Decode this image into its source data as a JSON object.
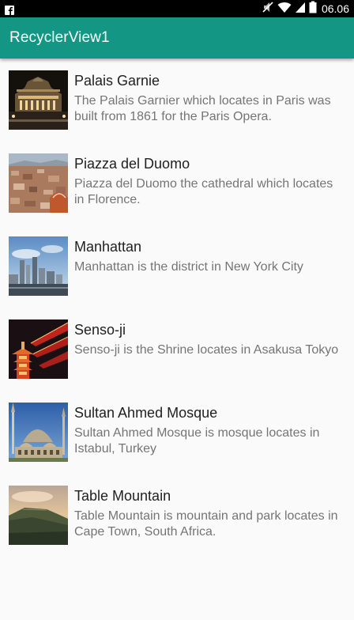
{
  "status_bar": {
    "time": "06.06",
    "icons": [
      "facebook-icon",
      "mute-icon",
      "wifi-icon",
      "signal-icon",
      "battery-icon"
    ]
  },
  "app_bar": {
    "title": "RecyclerView1",
    "color": "#139784"
  },
  "places": [
    {
      "title": "Palais Garnie",
      "description": "The Palais Garnier which locates in Paris was built from 1861 for the Paris Opera."
    },
    {
      "title": "Piazza del Duomo",
      "description": "Piazza del Duomo the cathedral which locates in Florence."
    },
    {
      "title": "Manhattan",
      "description": "Manhattan is the district in New York City"
    },
    {
      "title": "Senso-ji",
      "description": "Senso-ji is the Shrine locates in Asakusa Tokyo"
    },
    {
      "title": "Sultan Ahmed Mosque",
      "description": "Sultan Ahmed Mosque is mosque locates in Istabul, Turkey"
    },
    {
      "title": "Table Mountain",
      "description": "Table Mountain is mountain and park locates in Cape Town, South Africa."
    }
  ]
}
